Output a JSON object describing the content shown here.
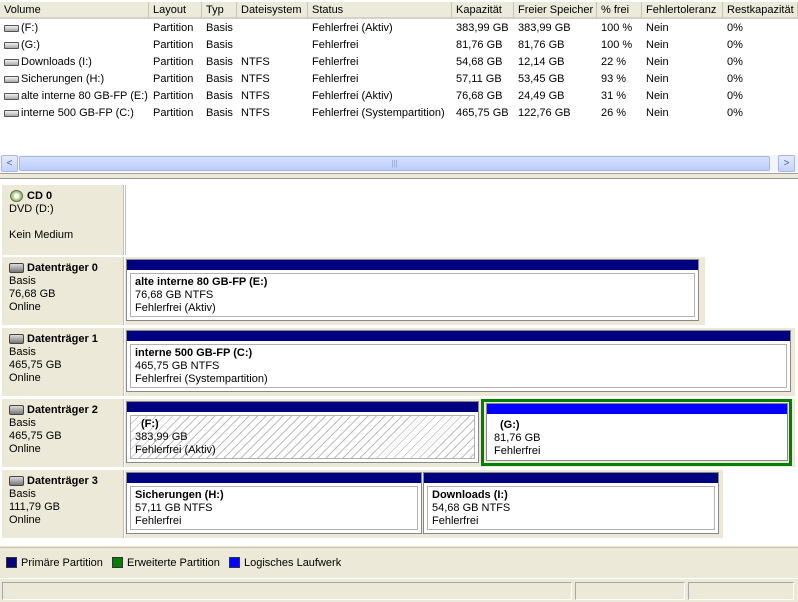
{
  "columns": [
    "Volume",
    "Layout",
    "Typ",
    "Dateisystem",
    "Status",
    "Kapazität",
    "Freier Speicher",
    "% frei",
    "Fehlertoleranz",
    "Restkapazität"
  ],
  "volumes": [
    {
      "volume": "(F:)",
      "layout": "Partition",
      "typ": "Basis",
      "fs": "",
      "status": "Fehlerfrei (Aktiv)",
      "kap": "383,99 GB",
      "frei": "383,99 GB",
      "pct": "100 %",
      "ft": "Nein",
      "rest": "0%"
    },
    {
      "volume": "(G:)",
      "layout": "Partition",
      "typ": "Basis",
      "fs": "",
      "status": "Fehlerfrei",
      "kap": "81,76 GB",
      "frei": "81,76 GB",
      "pct": "100 %",
      "ft": "Nein",
      "rest": "0%"
    },
    {
      "volume": "Downloads (I:)",
      "layout": "Partition",
      "typ": "Basis",
      "fs": "NTFS",
      "status": "Fehlerfrei",
      "kap": "54,68 GB",
      "frei": "12,14 GB",
      "pct": "22 %",
      "ft": "Nein",
      "rest": "0%"
    },
    {
      "volume": "Sicherungen (H:)",
      "layout": "Partition",
      "typ": "Basis",
      "fs": "NTFS",
      "status": "Fehlerfrei",
      "kap": "57,11 GB",
      "frei": "53,45 GB",
      "pct": "93 %",
      "ft": "Nein",
      "rest": "0%"
    },
    {
      "volume": "alte interne 80 GB-FP (E:)",
      "layout": "Partition",
      "typ": "Basis",
      "fs": "NTFS",
      "status": "Fehlerfrei (Aktiv)",
      "kap": "76,68 GB",
      "frei": "24,49 GB",
      "pct": "31 %",
      "ft": "Nein",
      "rest": "0%"
    },
    {
      "volume": "interne 500 GB-FP (C:)",
      "layout": "Partition",
      "typ": "Basis",
      "fs": "NTFS",
      "status": "Fehlerfrei (Systempartition)",
      "kap": "465,75 GB",
      "frei": "122,76 GB",
      "pct": "26 %",
      "ft": "Nein",
      "rest": "0%"
    }
  ],
  "scrollbar": {
    "left_arrow": "<",
    "right_arrow": ">",
    "grip": "|||"
  },
  "cd": {
    "title": "CD 0",
    "drive": "DVD (D:)",
    "medium": "Kein Medium"
  },
  "disks": [
    {
      "title": "Datenträger 0",
      "type": "Basis",
      "size": "76,68 GB",
      "state": "Online",
      "parts": [
        {
          "name": "alte interne 80 GB-FP  (E:)",
          "size": "76,68 GB NTFS",
          "status": "Fehlerfrei (Aktiv)"
        }
      ]
    },
    {
      "title": "Datenträger 1",
      "type": "Basis",
      "size": "465,75 GB",
      "state": "Online",
      "parts": [
        {
          "name": "interne 500 GB-FP  (C:)",
          "size": "465,75 GB NTFS",
          "status": "Fehlerfrei (Systempartition)"
        }
      ]
    },
    {
      "title": "Datenträger 2",
      "type": "Basis",
      "size": "465,75 GB",
      "state": "Online",
      "parts": [
        {
          "name": "(F:)",
          "size": "383,99 GB",
          "status": "Fehlerfrei (Aktiv)"
        },
        {
          "name": "(G:)",
          "size": "81,76 GB",
          "status": "Fehlerfrei"
        }
      ]
    },
    {
      "title": "Datenträger 3",
      "type": "Basis",
      "size": "111,79 GB",
      "state": "Online",
      "parts": [
        {
          "name": "Sicherungen  (H:)",
          "size": "57,11 GB NTFS",
          "status": "Fehlerfrei"
        },
        {
          "name": "Downloads  (I:)",
          "size": "54,68 GB NTFS",
          "status": "Fehlerfrei"
        }
      ]
    }
  ],
  "legend": [
    {
      "label": "Primäre Partition",
      "color": "#000080"
    },
    {
      "label": "Erweiterte Partition",
      "color": "#008000"
    },
    {
      "label": "Logisches Laufwerk",
      "color": "#0000ff"
    }
  ]
}
